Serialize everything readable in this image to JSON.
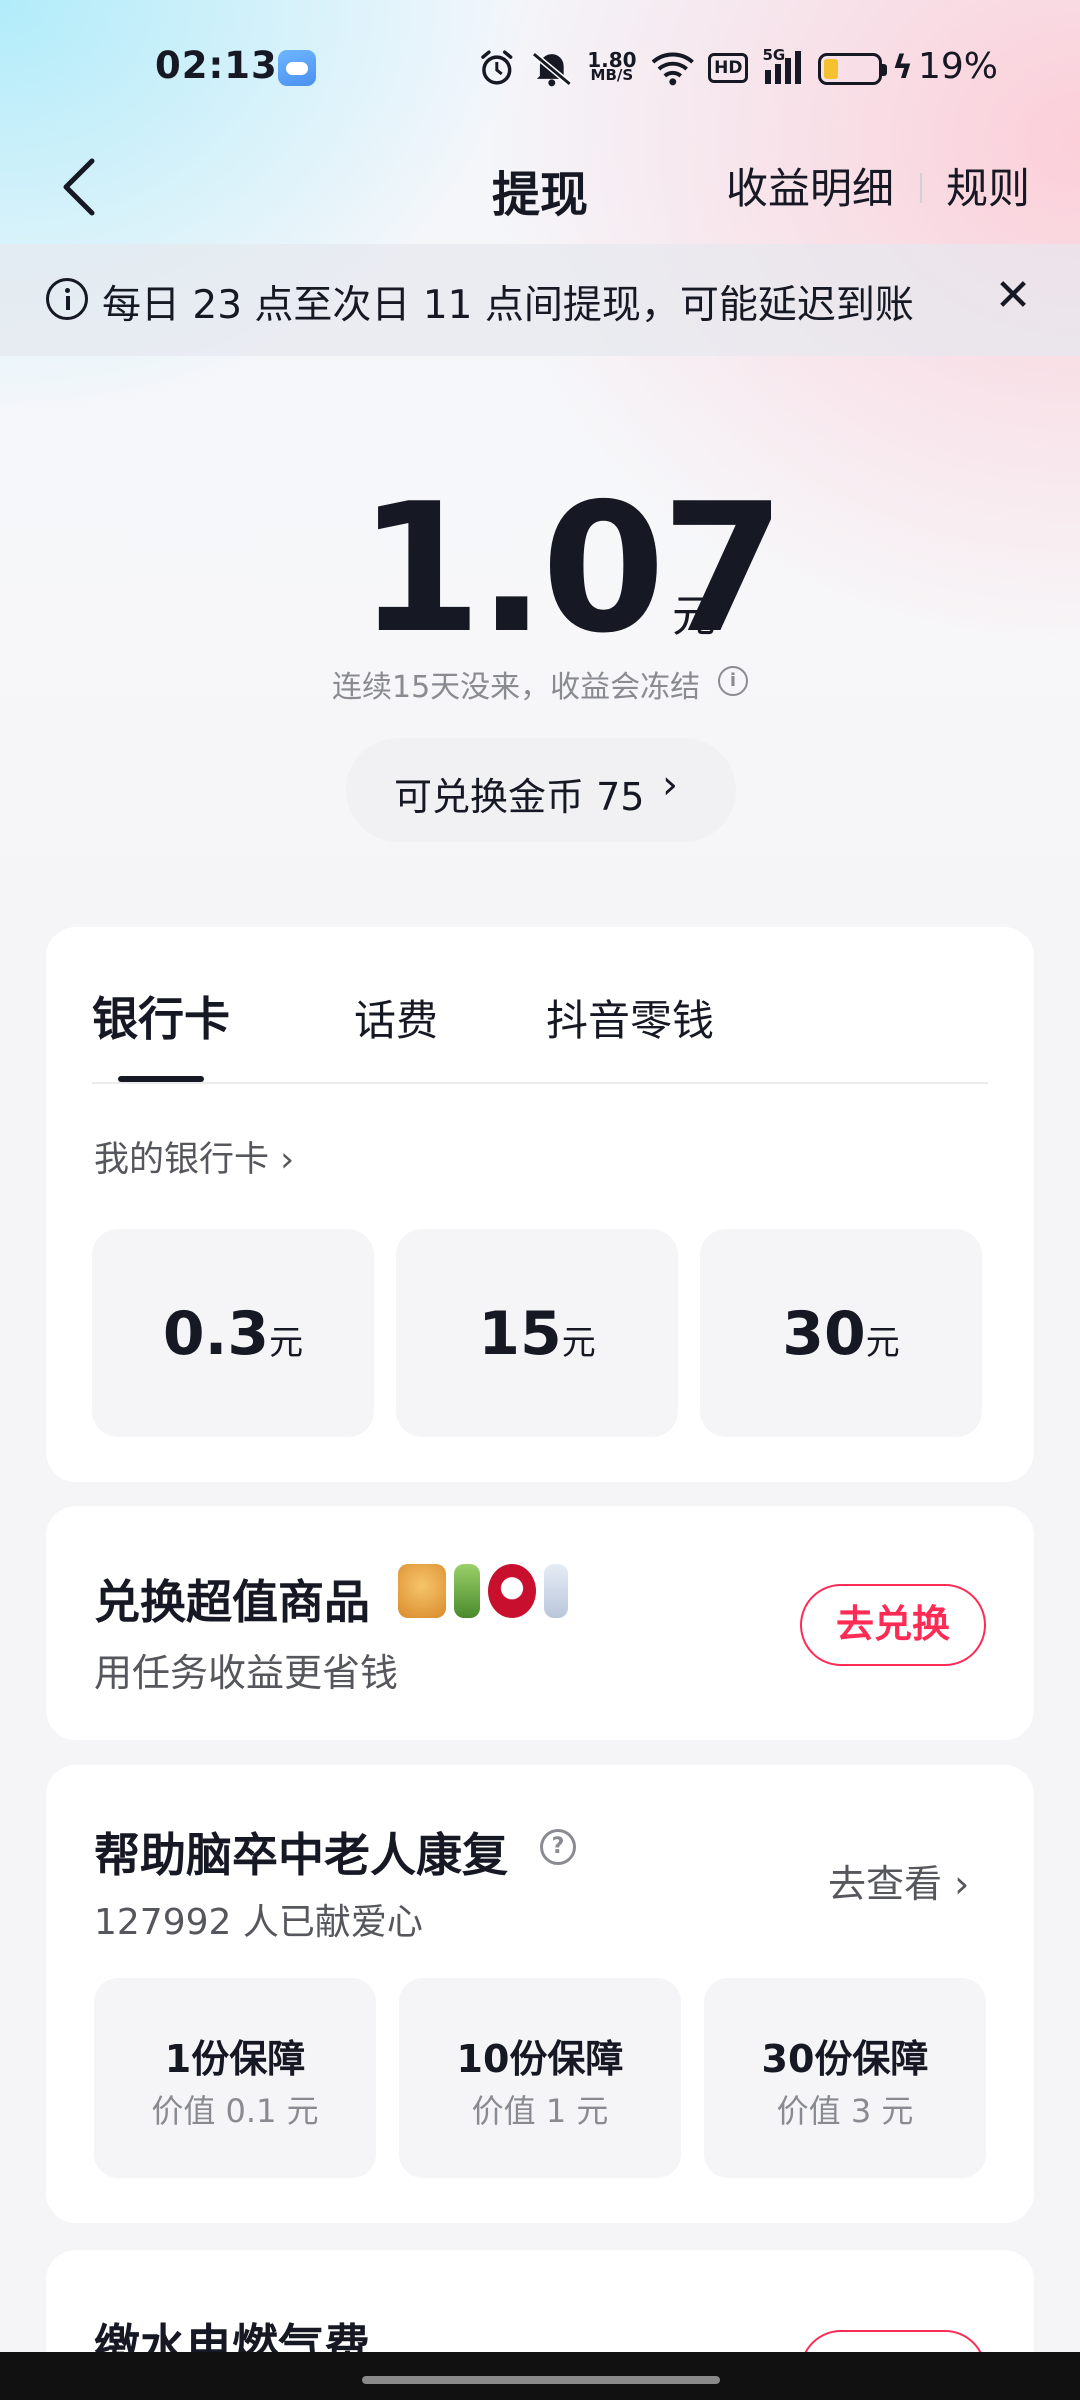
{
  "status_bar": {
    "time": "02:13",
    "net_speed_value": "1.80",
    "net_speed_unit": "MB/S",
    "hd_label": "HD",
    "signal_label": "5G",
    "battery_percent": "19%",
    "battery_level": 0.19
  },
  "nav": {
    "title": "提现",
    "detail_label": "收益明细",
    "rules_label": "规则"
  },
  "notice": {
    "text": "每日 23 点至次日 11 点间提现，可能延迟到账"
  },
  "balance": {
    "amount": "1.07",
    "unit": "元",
    "freeze_tip": "连续15天没来，收益会冻结",
    "coin_label": "可兑换金币 75",
    "coin_chevron": "›"
  },
  "withdraw": {
    "tabs": [
      {
        "label": "银行卡",
        "active": true
      },
      {
        "label": "话费",
        "active": false
      },
      {
        "label": "抖音零钱",
        "active": false
      }
    ],
    "my_bank_label": "我的银行卡 ›",
    "amounts": [
      {
        "value": "0.3",
        "unit": "元"
      },
      {
        "value": "15",
        "unit": "元"
      },
      {
        "value": "30",
        "unit": "元"
      }
    ]
  },
  "exchange": {
    "title": "兑换超值商品",
    "subtitle": "用任务收益更省钱",
    "button_label": "去兑换",
    "goods_icons": [
      "snack-icon",
      "drink-icon",
      "kfc-icon",
      "bottle-icon"
    ]
  },
  "charity": {
    "title": "帮助脑卒中老人康复",
    "count": "127992 人已献爱心",
    "link_label": "去查看 ›",
    "options": [
      {
        "title": "1份保障",
        "value": "价值 0.1 元"
      },
      {
        "title": "10份保障",
        "value": "价值 1 元"
      },
      {
        "title": "30份保障",
        "value": "价值 3 元"
      }
    ]
  },
  "utility": {
    "title": "缴水电燃气费"
  },
  "colors": {
    "accent": "#fe2c55",
    "text": "#161823",
    "muted": "#8a8b91"
  }
}
